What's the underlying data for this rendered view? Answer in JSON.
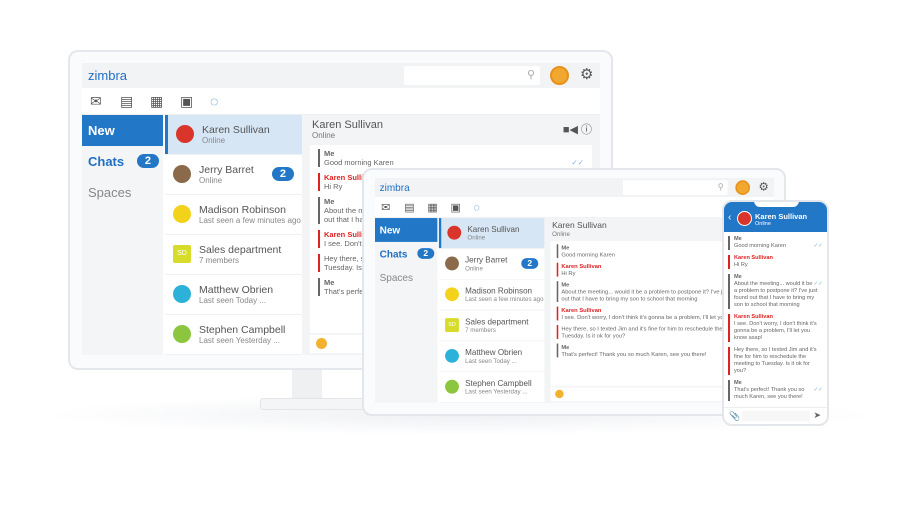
{
  "app": {
    "logo": "zimbra",
    "search_icon": "search-icon",
    "settings_icon": "gear-icon",
    "toolbar": [
      "mail-icon",
      "contacts-icon",
      "calendar-icon",
      "briefcase-icon",
      "chat-icon"
    ],
    "sidebar": [
      {
        "label": "New"
      },
      {
        "label": "Chats",
        "badge": "2"
      },
      {
        "label": "Spaces"
      }
    ],
    "contacts": [
      {
        "name": "Karen Sullivan",
        "status": "Online",
        "color": "#d9352b",
        "selected": true
      },
      {
        "name": "Jerry Barret",
        "status": "Online",
        "badge": "2",
        "color": "#8a6a4a"
      },
      {
        "name": "Madison Robinson",
        "status": "Last seen a few minutes ago",
        "color": "#f2d21b"
      },
      {
        "name": "Sales department",
        "status": "7 members",
        "initials": "SD",
        "color": "#d7dc2a"
      },
      {
        "name": "Matthew Obrien",
        "status": "Last seen Today ...",
        "color": "#2cb2d8"
      },
      {
        "name": "Stephen Campbell",
        "status": "Last seen Yesterday ...",
        "color": "#8cc63f"
      }
    ],
    "chat": {
      "title": "Karen Sullivan",
      "status": "Online",
      "messages": [
        {
          "from": "Me",
          "me": true,
          "text": "Good morning Karen",
          "read": true
        },
        {
          "from": "Karen Sullivan",
          "text": "Hi Ry"
        },
        {
          "from": "Me",
          "me": true,
          "text": "About the meeting... would it be a problem to postpone it? I've just found out that I have to bring my son to school that morning",
          "read": true
        },
        {
          "from": "Karen Sullivan",
          "text": "I see. Don't worry, I don't think it's gonna be a problem, I'll let you know asap!"
        },
        {
          "from": "",
          "text": "Hey there, so I texted Jim and it's fine for him to reschedule the meeting to Tuesday. Is it ok for you?",
          "cont": true
        },
        {
          "from": "Me",
          "me": true,
          "text": "That's perfect! Thank you so much Karen, see you there!",
          "read": true
        }
      ]
    }
  }
}
